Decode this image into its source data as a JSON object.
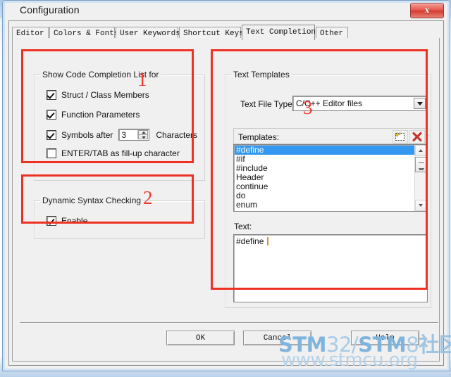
{
  "window": {
    "title": "Configuration",
    "close_label": "x"
  },
  "tabs": [
    {
      "label": "Editor",
      "active": false
    },
    {
      "label": "Colors & Fonts",
      "active": false
    },
    {
      "label": "User Keywords",
      "active": false
    },
    {
      "label": "Shortcut Keys",
      "active": false
    },
    {
      "label": "Text Completion",
      "active": true
    },
    {
      "label": "Other",
      "active": false
    }
  ],
  "code_completion": {
    "group_label": "Show Code Completion List for",
    "options": [
      {
        "label": "Struct / Class Members",
        "checked": true
      },
      {
        "label": "Function Parameters",
        "checked": true
      },
      {
        "label": "Symbols after",
        "checked": true
      },
      {
        "label": "ENTER/TAB as fill-up character",
        "checked": false
      }
    ],
    "symbols_value": "3",
    "symbols_suffix": "Characters"
  },
  "syntax_checking": {
    "group_label": "Dynamic Syntax Checking",
    "enable_label": "Enable",
    "enable_checked": true
  },
  "text_templates": {
    "group_label": "Text Templates",
    "file_types_label": "Text File Types:",
    "file_types_value": "C/C++ Editor files",
    "templates_label": "Templates:",
    "new_icon": "new-template-icon",
    "delete_icon": "delete-template-icon",
    "items": [
      "#define",
      "#if",
      "#include",
      "Header",
      "continue",
      "do",
      "enum"
    ],
    "selected_index": 0,
    "text_label": "Text:",
    "text_value": "#define "
  },
  "buttons": {
    "ok": "OK",
    "cancel": "Cancel",
    "help": "Help"
  },
  "annotations": [
    {
      "number": "1"
    },
    {
      "number": "2"
    },
    {
      "number": "3"
    }
  ],
  "watermark": {
    "line1_a": "STM",
    "line1_b": "32/",
    "line1_c": "STM",
    "line1_d": "8",
    "line1_e": "社区",
    "line2": "www.stmcu.org"
  },
  "colors": {
    "annotation": "#ef3124",
    "selection": "#3399f0",
    "caret": "#e08a2e",
    "watermark": "#a8cbe6"
  }
}
